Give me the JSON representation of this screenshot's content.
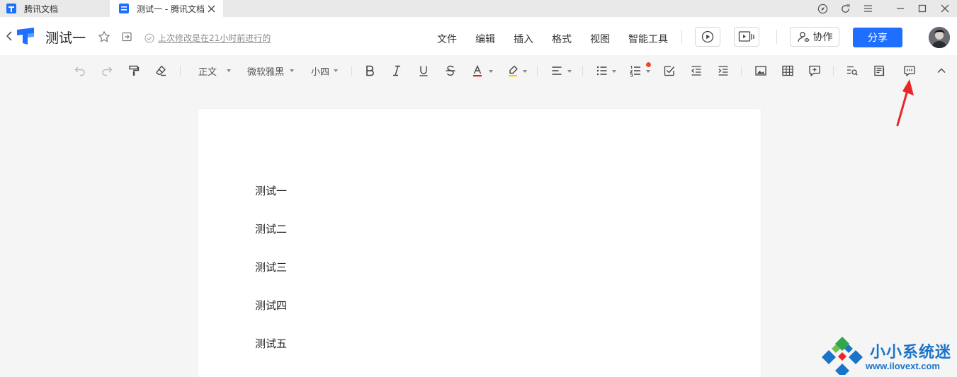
{
  "tabs": [
    {
      "label": "腾讯文档"
    },
    {
      "label": "测试一 - 腾讯文档"
    }
  ],
  "header": {
    "doc_title": "测试一",
    "save_status": "上次修改是在21小时前进行的",
    "menus": [
      "文件",
      "编辑",
      "插入",
      "格式",
      "视图",
      "智能工具"
    ],
    "collab_label": "协作",
    "share_label": "分享"
  },
  "toolbar": {
    "paragraph_style": "正文",
    "font_family": "微软雅黑",
    "font_size": "小四",
    "icons": [
      "undo-icon",
      "redo-icon",
      "format-painter-icon",
      "clear-format-icon",
      "bold-icon",
      "italic-icon",
      "underline-icon",
      "strikethrough-icon",
      "font-color-icon",
      "highlight-icon",
      "align-icon",
      "bullet-list-icon",
      "numbered-list-icon",
      "checklist-icon",
      "outdent-icon",
      "indent-icon",
      "image-icon",
      "table-icon",
      "insert-comment-icon",
      "find-icon",
      "document-info-icon",
      "comment-icon",
      "collapse-icon"
    ]
  },
  "document": {
    "paragraphs": [
      "测试一",
      "测试二",
      "测试三",
      "测试四",
      "测试五"
    ]
  },
  "watermark": {
    "title": "小小系统迷",
    "url": "www.ilovext.com"
  },
  "colors": {
    "brand_blue": "#1e6fff",
    "annotation_red": "#e8262a",
    "font_color_red": "#e02020",
    "highlight_yellow": "#f5d000"
  }
}
